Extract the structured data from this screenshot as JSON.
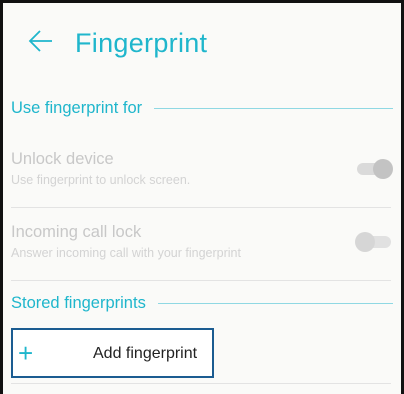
{
  "header": {
    "back_icon": "arrow-left-icon",
    "title": "Fingerprint"
  },
  "sections": {
    "use_for": {
      "label": "Use fingerprint for"
    },
    "stored": {
      "label": "Stored fingerprints"
    }
  },
  "settings": [
    {
      "title": "Unlock device",
      "subtitle": "Use fingerprint to unlock screen.",
      "enabled": true
    },
    {
      "title": "Incoming call lock",
      "subtitle": "Answer incoming call with your fingerprint",
      "enabled": false
    }
  ],
  "add_fingerprint": {
    "icon": "plus-icon",
    "symbol": "+",
    "label": "Add fingerprint"
  },
  "colors": {
    "accent": "#1fb6cc",
    "focus_border": "#1b5c91",
    "disabled_text": "#c8c8c8"
  }
}
